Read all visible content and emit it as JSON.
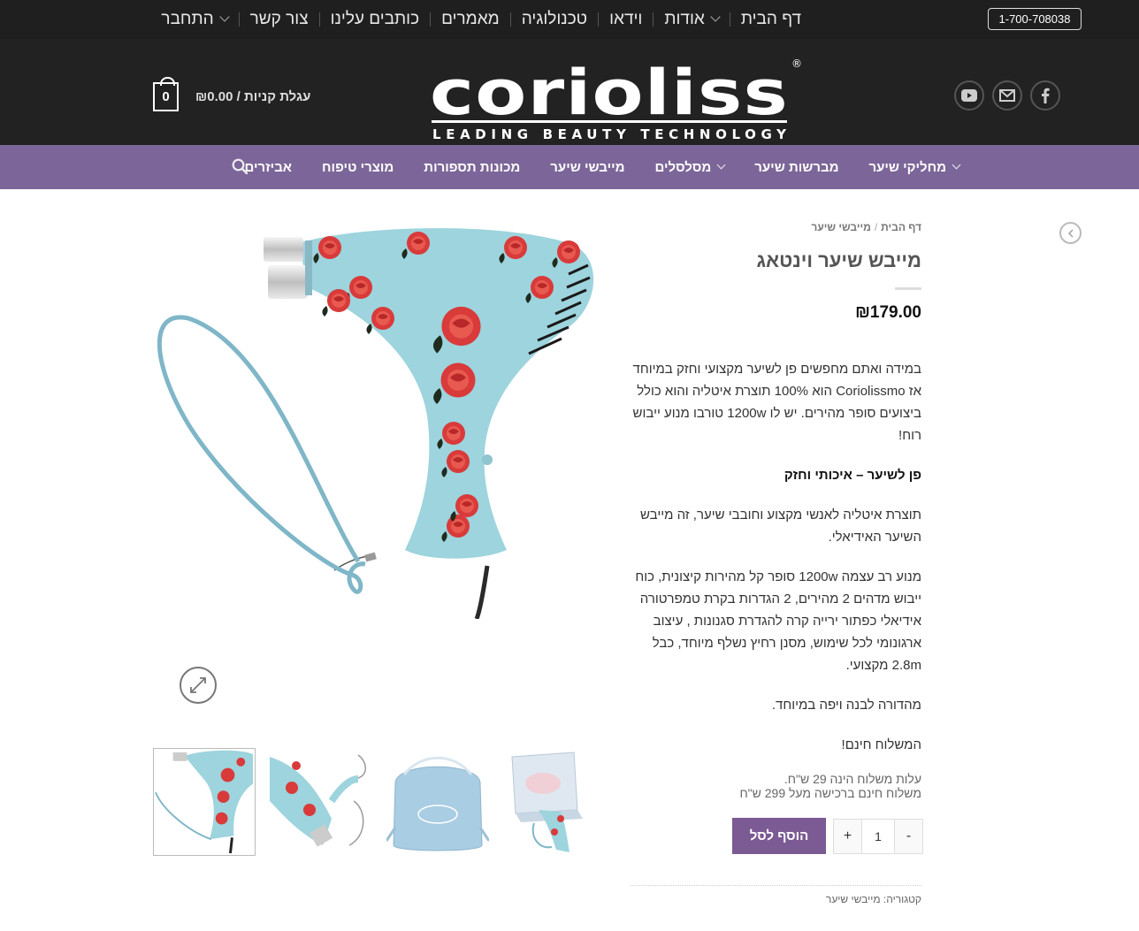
{
  "topbar": {
    "nav": [
      {
        "label": "דף הבית",
        "dropdown": false
      },
      {
        "label": "אודות",
        "dropdown": true
      },
      {
        "label": "וידאו",
        "dropdown": false
      },
      {
        "label": "טכנולוגיה",
        "dropdown": false
      },
      {
        "label": "מאמרים",
        "dropdown": false
      },
      {
        "label": "כותבים עלינו",
        "dropdown": false
      },
      {
        "label": "צור קשר",
        "dropdown": false
      },
      {
        "label": "התחבר",
        "dropdown": true
      }
    ],
    "phone": "1-700-708038"
  },
  "header": {
    "cart_label": "עגלת קניות / ₪0.00",
    "cart_count": "0",
    "logo_text": "corioliss",
    "logo_tagline": "LEADING BEAUTY TECHNOLOGY",
    "logo_mark": "®",
    "social_icons": [
      "facebook-icon",
      "email-icon",
      "youtube-icon"
    ]
  },
  "mainnav": [
    {
      "label": "מחליקי שיער",
      "dropdown": true
    },
    {
      "label": "מברשות שיער",
      "dropdown": false
    },
    {
      "label": "מסלסלים",
      "dropdown": true
    },
    {
      "label": "מייבשי שיער",
      "dropdown": false
    },
    {
      "label": "מכונות תספורות",
      "dropdown": false
    },
    {
      "label": "מוצרי טיפוח",
      "dropdown": false
    },
    {
      "label": "אביזרים",
      "dropdown": false
    }
  ],
  "product": {
    "breadcrumb": [
      "דף הבית",
      "מייבשי שיער"
    ],
    "title": "מייבש שיער וינטאג",
    "price": "₪179.00",
    "description": [
      {
        "text": "במידה ואתם מחפשים פן לשיער מקצועי וחזק במיוחד אז Coriolissmo הוא 100% תוצרת איטליה והוא כולל ביצועים סופר מהירים. יש לו 1200w טורבו מנוע ייבוש רוח!",
        "bold": false
      },
      {
        "text": "פן לשיער – איכותי וחזק",
        "bold": true
      },
      {
        "text": "תוצרת איטליה לאנשי מקצוע וחובבי שיער, זה מייבש השיער האידיאלי.",
        "bold": false
      },
      {
        "text": "מנוע רב עצמה 1200w סופר קל מהירות קיצונית, כוח ייבוש מדהים 2 מהירים, 2 הגדרות בקרת טמפרטורה אידיאלי כפתור ירייה קרה להגדרת סגנונות , עיצוב ארגונומי לכל שימוש, מסנן רחיץ נשלף מיוחד, כבל 2.8m מקצועי.",
        "bold": false
      },
      {
        "text": "מהדורה לבנה ויפה במיוחד.",
        "bold": false
      },
      {
        "text": "המשלוח חינם!",
        "bold": false
      }
    ],
    "shipping": [
      "עלות משלוח הינה 29 ש\"ח.",
      "משלוח חינם ברכישה מעל 299 ש\"ח"
    ],
    "quantity": "1",
    "minus": "-",
    "plus": "+",
    "add_to_cart": "הוסף לסל",
    "category": "קטגוריה: מייבשי שיער"
  },
  "colors": {
    "topbar": "#1f1f1f",
    "header": "#222222",
    "nav": "#7c6699",
    "button": "#7c5a93",
    "dryer_body": "#9dd4dd",
    "rose": "#d93a3a"
  }
}
